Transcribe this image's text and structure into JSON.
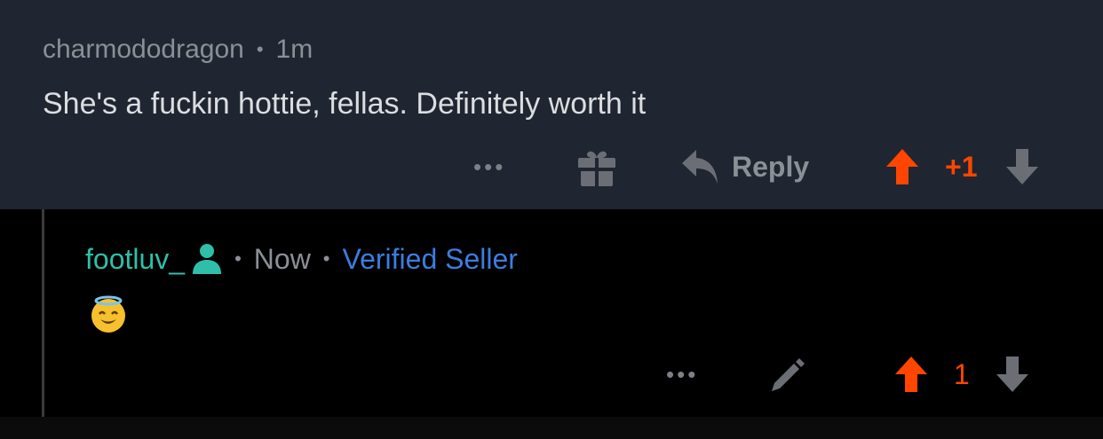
{
  "top_comment": {
    "username": "charmododragon",
    "separator": "•",
    "time": "1m",
    "body": "She's a fuckin hottie, fellas. Definitely worth it",
    "actions": {
      "more": "•••",
      "award_icon": "gift-icon",
      "reply_icon": "reply-arrow-icon",
      "reply_label": "Reply",
      "vote_count": "+1",
      "vote_color": "#ff4500"
    }
  },
  "reply_comment": {
    "username": "footluv_",
    "user_icon": "person-icon",
    "separator": "•",
    "time": "Now",
    "flair": "Verified Seller",
    "emoji": "😇",
    "actions": {
      "more": "•••",
      "edit_icon": "pencil-icon",
      "vote_count": "1",
      "vote_color": "#ff4500"
    }
  },
  "colors": {
    "top_background": "#1f2631",
    "reply_background": "#000000",
    "username_reply": "#2fbfa8",
    "flair": "#3c7de0",
    "upvote": "#ff4500",
    "muted": "#8b8f96"
  }
}
